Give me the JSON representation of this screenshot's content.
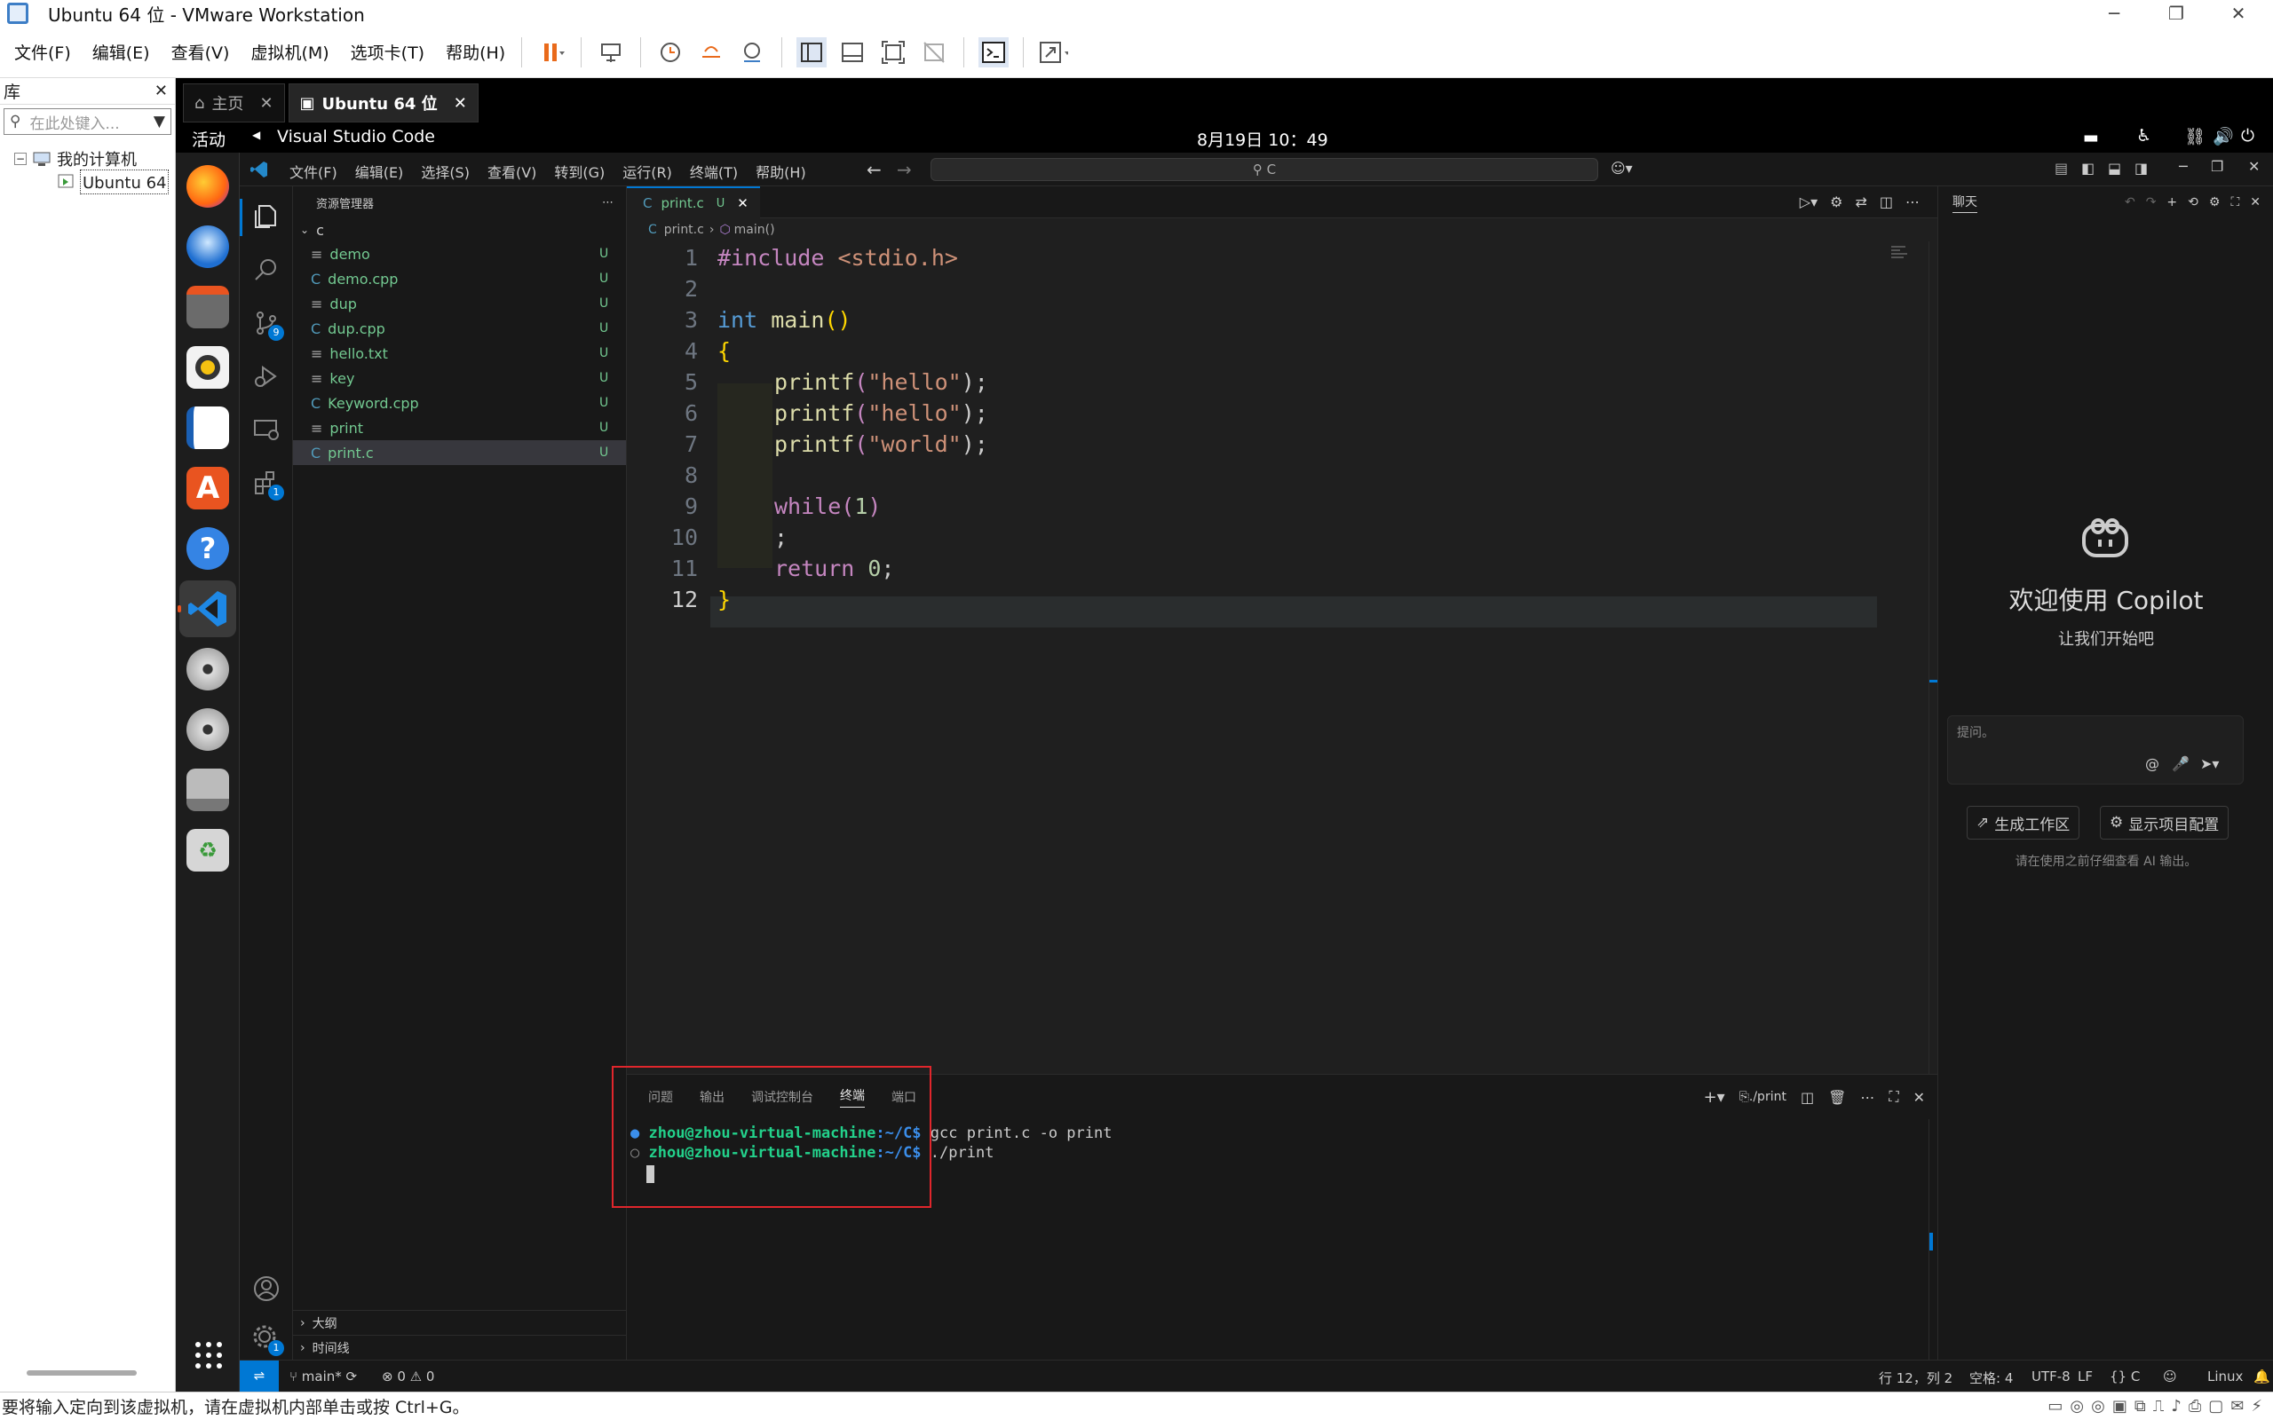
{
  "window": {
    "title": "Ubuntu 64 位 - VMware Workstation"
  },
  "menu": [
    "文件(F)",
    "编辑(E)",
    "查看(V)",
    "虚拟机(M)",
    "选项卡(T)",
    "帮助(H)"
  ],
  "library": {
    "title": "库",
    "search_placeholder": "在此处键入...",
    "root": "我的计算机",
    "vm": "Ubuntu 64 位"
  },
  "vm_tabs": [
    {
      "label": "主页"
    },
    {
      "label": "Ubuntu 64 位"
    }
  ],
  "ubuntu": {
    "activities": "活动",
    "app_name": "Visual Studio Code",
    "clock": "8月19日  10：49"
  },
  "vscode": {
    "menu": [
      "文件(F)",
      "编辑(E)",
      "选择(S)",
      "查看(V)",
      "转到(G)",
      "运行(R)",
      "终端(T)",
      "帮助(H)"
    ],
    "search_text": "C",
    "scm_badge": "9",
    "ext_badge": "1",
    "settings_badge": "1",
    "explorer": {
      "title": "资源管理器",
      "folder": "c",
      "files": [
        {
          "name": "demo",
          "status": "U"
        },
        {
          "name": "demo.cpp",
          "status": "U"
        },
        {
          "name": "dup",
          "status": "U"
        },
        {
          "name": "dup.cpp",
          "status": "U"
        },
        {
          "name": "hello.txt",
          "status": "U"
        },
        {
          "name": "key",
          "status": "U"
        },
        {
          "name": "Keyword.cpp",
          "status": "U"
        },
        {
          "name": "print",
          "status": "U"
        },
        {
          "name": "print.c",
          "status": "U"
        }
      ],
      "outline": "大纲",
      "timeline": "时间线"
    },
    "editor": {
      "tab_label": "print.c",
      "tab_status": "U",
      "breadcrumb_file": "print.c",
      "breadcrumb_symbol": "main()",
      "line_numbers": [
        "1",
        "2",
        "3",
        "4",
        "5",
        "6",
        "7",
        "8",
        "9",
        "10",
        "11",
        "12"
      ],
      "code": {
        "l1_a": "#include ",
        "l1_b": "<stdio.h>",
        "l3_a": "int ",
        "l3_b": "main",
        "l3_c": "()",
        "l4": "{",
        "l5_a": "printf",
        "l5_b": "(",
        "l5_c": "\"hello\"",
        "l5_d": ");",
        "l6_a": "printf",
        "l6_b": "(",
        "l6_c": "\"hello\"",
        "l6_d": ");",
        "l7_a": "printf",
        "l7_b": "(",
        "l7_c": "\"world\"",
        "l7_d": ");",
        "l9_a": "while",
        "l9_b": "(",
        "l9_c": "1",
        "l9_d": ")",
        "l10": ";",
        "l11_a": "return ",
        "l11_b": "0",
        "l11_c": ";",
        "l12": "}"
      }
    },
    "panel": {
      "tabs": [
        "问题",
        "输出",
        "调试控制台",
        "终端",
        "端口"
      ],
      "active_tab": "终端",
      "task": "./print",
      "prompt_user": "zhou@zhou-virtual-machine",
      "prompt_path": ":~/C$",
      "cmd1": " gcc print.c -o print",
      "cmd2": " ./print"
    },
    "chat": {
      "title": "聊天",
      "welcome": "欢迎使用 Copilot",
      "subtitle": "让我们开始吧",
      "input_placeholder": "提问。",
      "btn_workspace": "生成工作区",
      "btn_config": "显示项目配置",
      "disclaimer": "请在使用之前仔细查看 AI 输出。"
    },
    "status": {
      "branch": "main*",
      "errors": "0",
      "warnings": "0",
      "position": "行 12，列 2",
      "spaces": "空格: 4",
      "encoding": "UTF-8",
      "eol": "LF",
      "language": "C",
      "platform": "Linux"
    }
  },
  "vm_status": "要将输入定向到该虚拟机，请在虚拟机内部单击或按 Ctrl+G。",
  "colors": {
    "accent": "#0078d4",
    "git_untracked": "#73c991",
    "terminal_highlight": "#e0262c"
  }
}
